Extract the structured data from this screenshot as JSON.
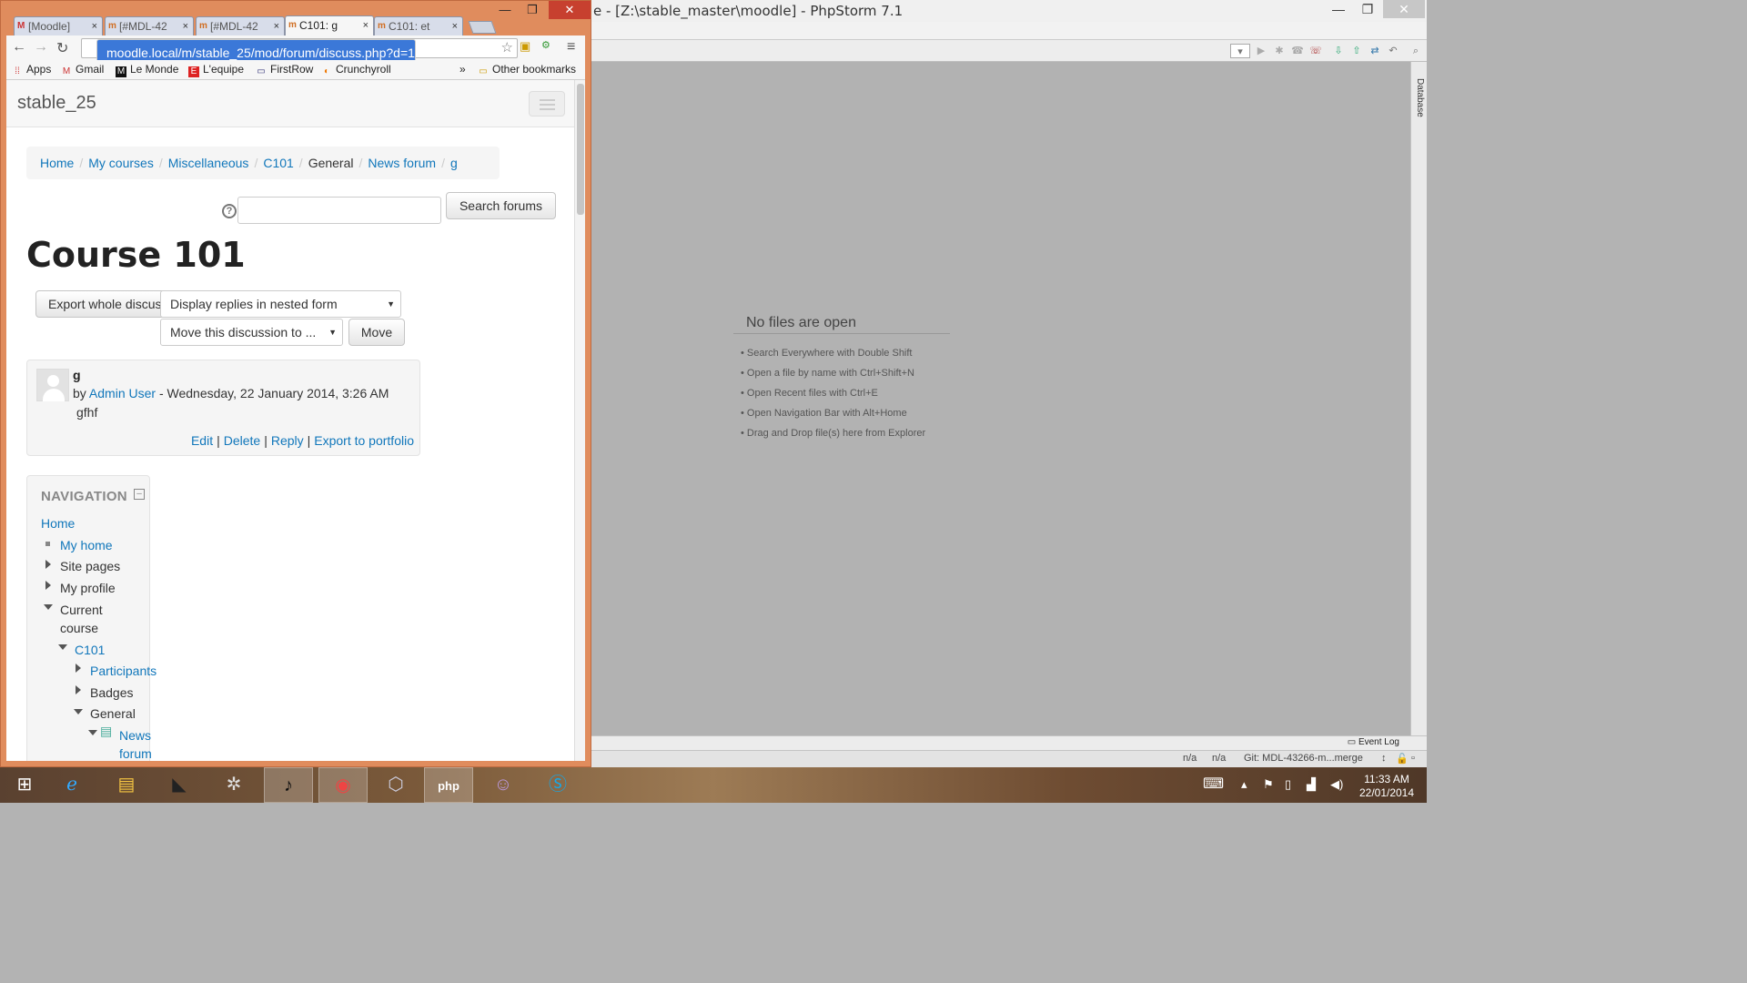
{
  "phpstorm": {
    "title": "e - [Z:\\stable_master\\moodle] - PhpStorm 7.1",
    "sidebar_tab": "Database",
    "empty": {
      "heading": "No files are open",
      "hints": [
        "• Search Everywhere with Double Shift",
        "• Open a file by name with Ctrl+Shift+N",
        "• Open Recent files with Ctrl+E",
        "• Open Navigation Bar with Alt+Home",
        "• Drag and Drop file(s) here from Explorer"
      ]
    },
    "event_log": "Event Log",
    "status": {
      "pos1": "n/a",
      "pos2": "n/a",
      "vcs": "Git: MDL-43266-m...merge"
    }
  },
  "chrome": {
    "tabs": [
      {
        "label": "[Moodle]"
      },
      {
        "label": "[#MDL-42"
      },
      {
        "label": "[#MDL-42"
      },
      {
        "label": "C101: g"
      },
      {
        "label": "C101: et"
      }
    ],
    "url": "moodle.local/m/stable_25/mod/forum/discuss.php?d=1",
    "bookmarks": [
      "Apps",
      "Gmail",
      "Le Monde",
      "L'equipe",
      "FirstRow",
      "Crunchyroll"
    ],
    "bookmarks_more": "»",
    "other_bookmarks": "Other bookmarks"
  },
  "moodle": {
    "site_name": "stable_25",
    "breadcrumb": [
      "Home",
      "My courses",
      "Miscellaneous",
      "C101",
      "General",
      "News forum",
      "g"
    ],
    "search_button": "Search forums",
    "help_icon": "?",
    "course_title": "Course 101",
    "export_button": "Export whole discussion",
    "display_select": "Display replies in nested form",
    "move_select": "Move this discussion to ...",
    "move_button": "Move",
    "post": {
      "subject": "g",
      "by": "by",
      "author": "Admin User",
      "date": "- Wednesday, 22 January 2014, 3:26 AM",
      "body": "gfhf",
      "commands": [
        "Edit",
        "Delete",
        "Reply",
        "Export to portfolio"
      ]
    },
    "navigation": {
      "heading": "NAVIGATION",
      "items": [
        "Home",
        "My home",
        "Site pages",
        "My profile",
        "Current",
        "course",
        "C101",
        "Participants",
        "Badges",
        "General",
        "News",
        "forum"
      ]
    }
  },
  "taskbar": {
    "time": "11:33 AM",
    "date": "22/01/2014"
  }
}
